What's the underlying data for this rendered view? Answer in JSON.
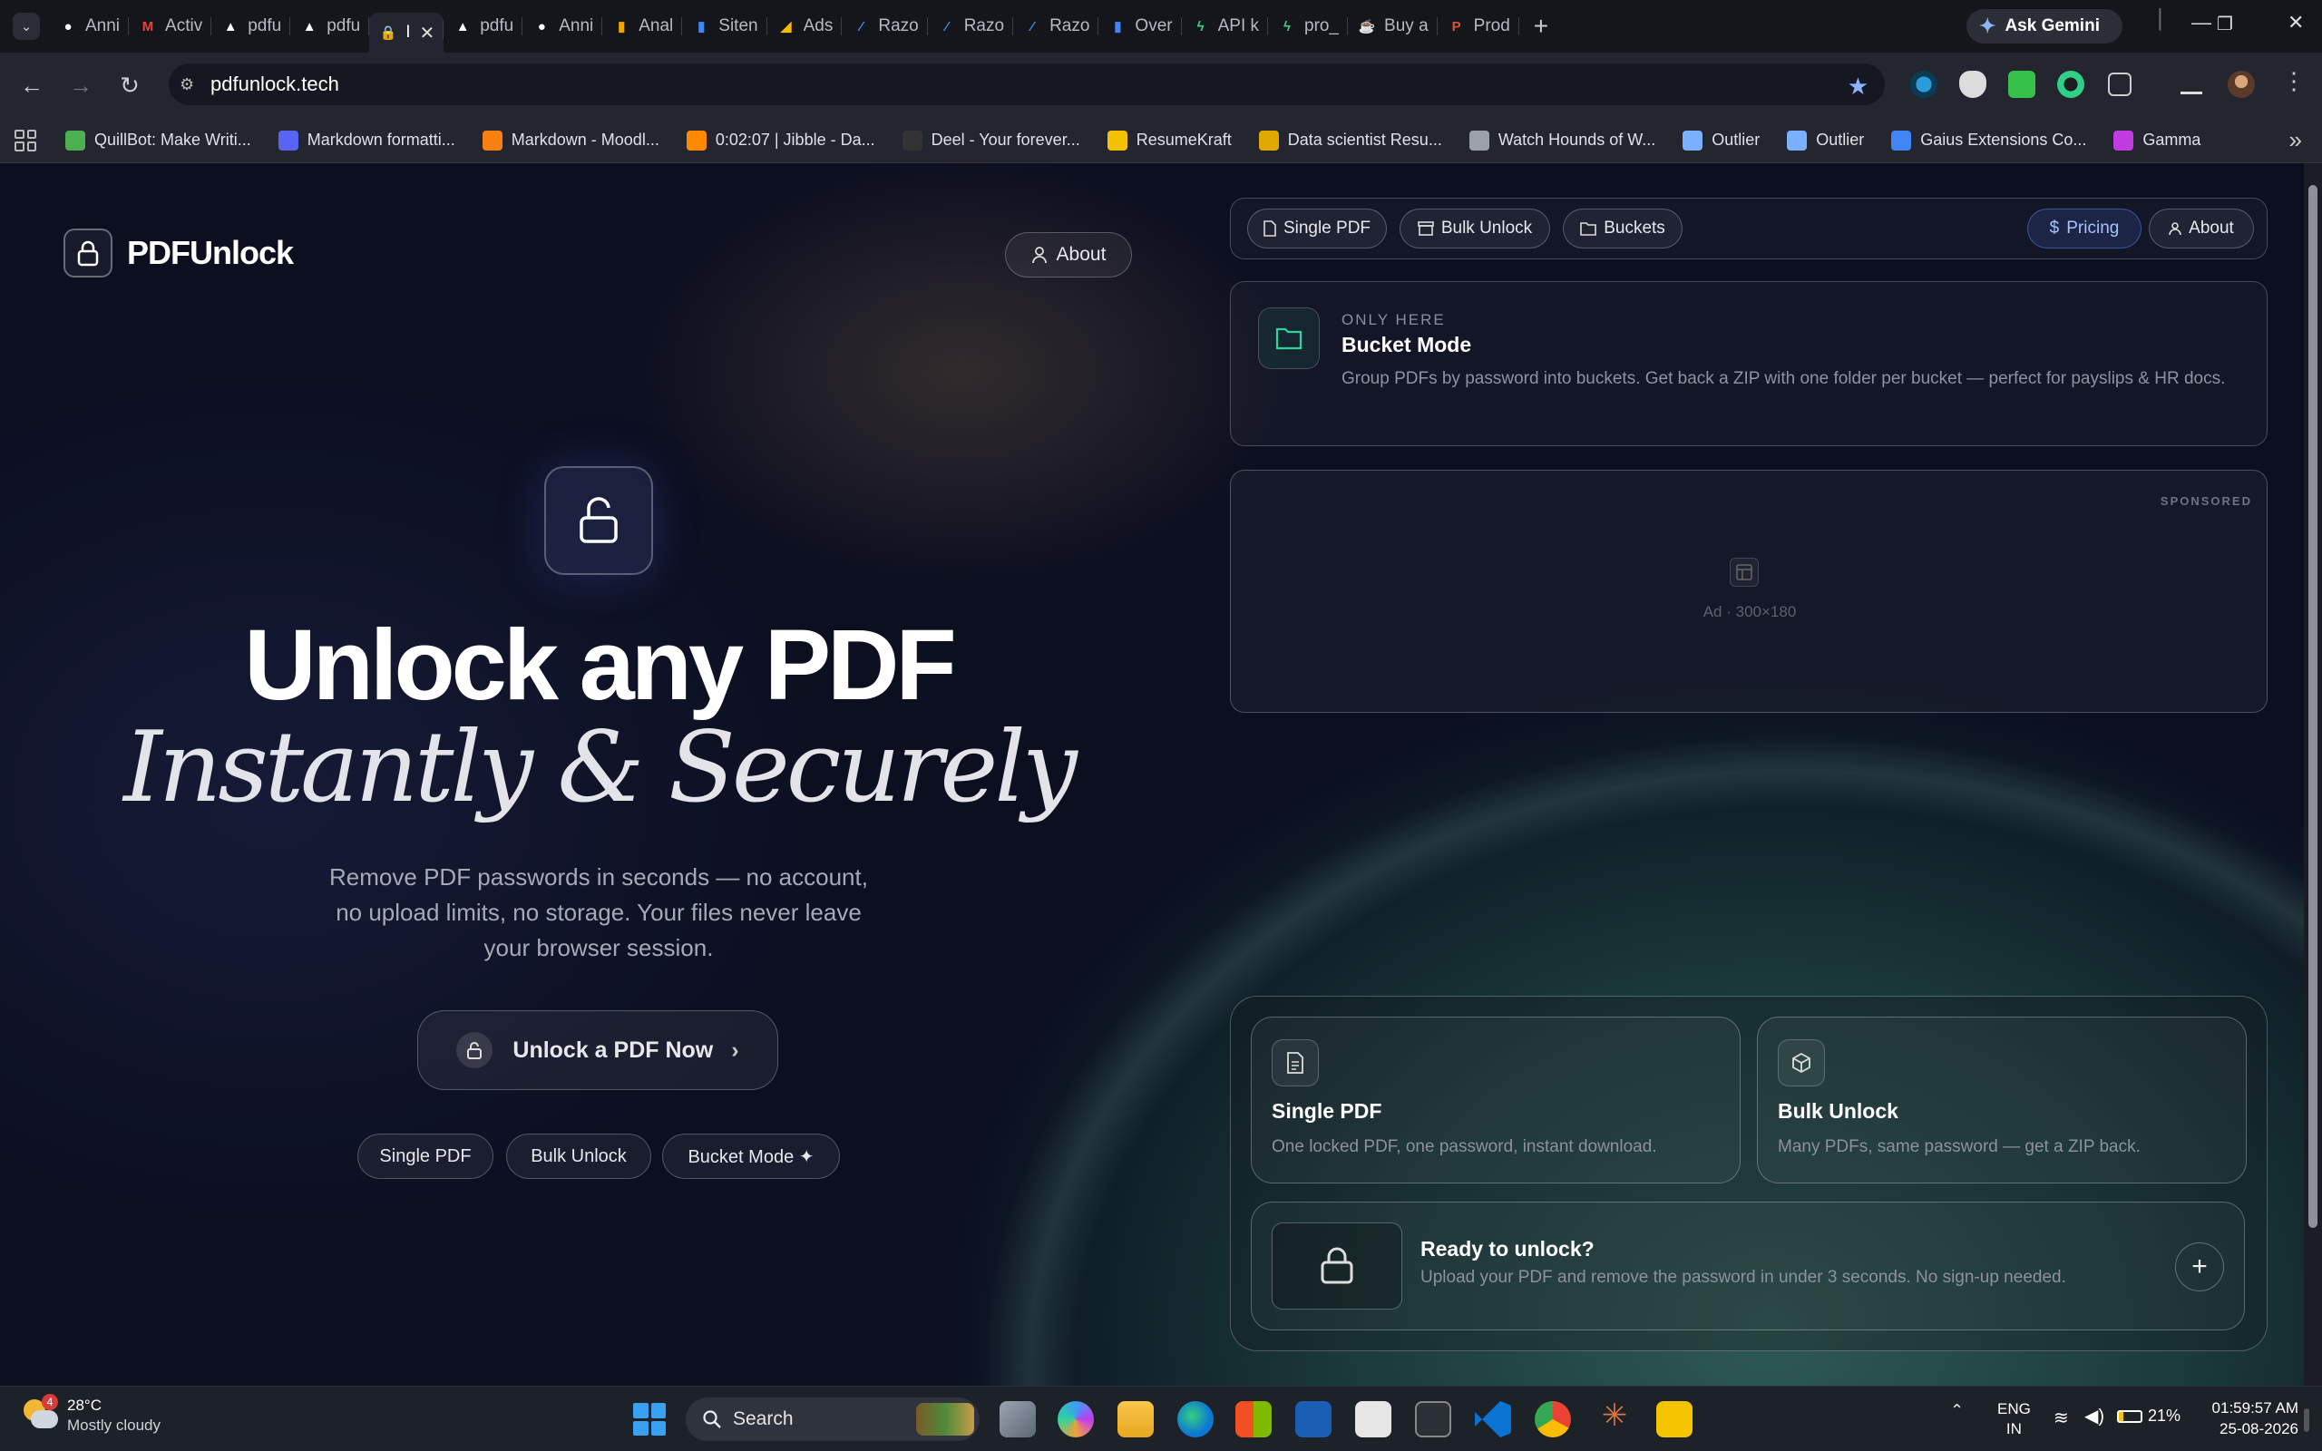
{
  "browser": {
    "tabs": [
      {
        "label": "Anni",
        "icon": "github-icon",
        "color": "#ffffff"
      },
      {
        "label": "Activ",
        "icon": "gmail-icon",
        "color": "#ea4335"
      },
      {
        "label": "pdfu",
        "icon": "vercel-icon",
        "color": "#ffffff"
      },
      {
        "label": "pdfu",
        "icon": "vercel-icon",
        "color": "#ffffff"
      },
      {
        "label": "I",
        "icon": "pdfunlock-icon",
        "color": "#6a5cff",
        "active": true
      },
      {
        "label": "pdfu",
        "icon": "vercel-icon",
        "color": "#ffffff"
      },
      {
        "label": "Anni",
        "icon": "github-icon",
        "color": "#ffffff"
      },
      {
        "label": "Anal",
        "icon": "analytics-icon",
        "color": "#f4a300"
      },
      {
        "label": "Siten",
        "icon": "search-console-icon",
        "color": "#4285f4"
      },
      {
        "label": "Ads",
        "icon": "google-ads-icon",
        "color": "#fbbc04"
      },
      {
        "label": "Razo",
        "icon": "razorpay-icon",
        "color": "#3395ff"
      },
      {
        "label": "Razo",
        "icon": "razorpay-icon",
        "color": "#3395ff"
      },
      {
        "label": "Razo",
        "icon": "razorpay-icon",
        "color": "#3395ff"
      },
      {
        "label": "Over",
        "icon": "analytics-icon",
        "color": "#4285f4"
      },
      {
        "label": "API k",
        "icon": "supabase-icon",
        "color": "#3ecf8e"
      },
      {
        "label": "pro_",
        "icon": "supabase-icon",
        "color": "#3ecf8e"
      },
      {
        "label": "Buy a",
        "icon": "buymeacoffee-icon",
        "color": "#ff5f2e"
      },
      {
        "label": "Prod",
        "icon": "producthunt-icon",
        "color": "#da552f"
      }
    ],
    "gemini_label": "Ask Gemini",
    "url": "pdfunlock.tech",
    "bookmarks": [
      {
        "label": "QuillBot: Make Writi...",
        "icon": "quillbot-icon",
        "color": "#4caf50"
      },
      {
        "label": "Markdown formatti...",
        "icon": "discord-icon",
        "color": "#5865f2"
      },
      {
        "label": "Markdown - Moodl...",
        "icon": "moodle-icon",
        "color": "#f98012"
      },
      {
        "label": "0:02:07 | Jibble - Da...",
        "icon": "jibble-icon",
        "color": "#ff8a00"
      },
      {
        "label": "Deel - Your forever...",
        "icon": "deel-icon",
        "color": "#333333"
      },
      {
        "label": "ResumeKraft",
        "icon": "resumekraft-icon",
        "color": "#f2c200"
      },
      {
        "label": "Data scientist Resu...",
        "icon": "resume-icon",
        "color": "#e0a800"
      },
      {
        "label": "Watch Hounds of W...",
        "icon": "globe-icon",
        "color": "#9aa0a6"
      },
      {
        "label": "Outlier",
        "icon": "outlier-icon",
        "color": "#7ab0ff"
      },
      {
        "label": "Outlier",
        "icon": "outlier-icon",
        "color": "#7ab0ff"
      },
      {
        "label": "Gaius Extensions Co...",
        "icon": "docs-icon",
        "color": "#4285f4"
      },
      {
        "label": "Gamma",
        "icon": "gamma-icon",
        "color": "#c03ce0"
      }
    ]
  },
  "site": {
    "logo_text": "PDFUnlock",
    "about_left": "About",
    "headline": "Unlock any PDF",
    "headline_italic": "Instantly & Securely",
    "subtitle": "Remove PDF passwords in seconds — no account, no upload limits, no storage. Your files never leave your browser session.",
    "cta": "Unlock a PDF Now",
    "chips": [
      "Single PDF",
      "Bulk Unlock",
      "Bucket Mode ✦"
    ],
    "nav": {
      "single": "Single PDF",
      "bulk": "Bulk Unlock",
      "buckets": "Buckets",
      "pricing": "Pricing",
      "about": "About"
    },
    "bucket": {
      "eyebrow": "ONLY HERE",
      "title": "Bucket Mode",
      "desc": "Group PDFs by password into buckets. Get back a ZIP with one folder per bucket — perfect for payslips & HR docs."
    },
    "ad": {
      "label": "SPONSORED",
      "size": "Ad · 300×180"
    },
    "cards": [
      {
        "title": "Single PDF",
        "desc": "One locked PDF, one password, instant download."
      },
      {
        "title": "Bulk Unlock",
        "desc": "Many PDFs, same password — get a ZIP back."
      }
    ],
    "ready": {
      "title": "Ready to unlock?",
      "desc": "Upload your PDF and remove the password in under 3 seconds. No sign-up needed."
    }
  },
  "taskbar": {
    "weather_temp": "28°C",
    "weather_desc": "Mostly cloudy",
    "weather_badge": "4",
    "search_label": "Search",
    "lang_1": "ENG",
    "lang_2": "IN",
    "battery": "21%",
    "time": "01:59:57 AM",
    "date": "25-08-2026"
  }
}
